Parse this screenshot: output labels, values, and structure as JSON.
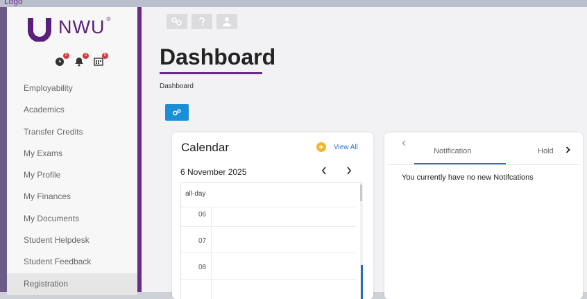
{
  "top_strip_text": "Logo",
  "brand": {
    "name": "NWU",
    "registered": "®"
  },
  "alerts": [
    {
      "icon": "clock-icon",
      "count": "0"
    },
    {
      "icon": "bell-icon",
      "count": "0"
    },
    {
      "icon": "calendar-icon",
      "count": "0"
    }
  ],
  "sidebar": {
    "items": [
      {
        "label": "Employability"
      },
      {
        "label": "Academics"
      },
      {
        "label": "Transfer Credits"
      },
      {
        "label": "My Exams"
      },
      {
        "label": "My Profile"
      },
      {
        "label": "My Finances"
      },
      {
        "label": "My Documents"
      },
      {
        "label": "Student Helpdesk"
      },
      {
        "label": "Student Feedback"
      },
      {
        "label": "Registration"
      }
    ],
    "active_item": "Registration"
  },
  "toolbar": {
    "icons": [
      "share-icon",
      "help-icon",
      "user-icon"
    ]
  },
  "page": {
    "title": "Dashboard",
    "breadcrumb": "Dashboard"
  },
  "calendar": {
    "title": "Calendar",
    "view_all": "View All",
    "date": "6 November 2025",
    "all_day": "all-day",
    "hours": [
      "06",
      "07",
      "08"
    ]
  },
  "notifications": {
    "tabs": [
      "Notification",
      "Hold"
    ],
    "active_tab": "Notification",
    "message": "You currently have no new Notifcations"
  },
  "colors": {
    "brand_purple": "#5b1f7a",
    "accent_blue": "#1a8fd6",
    "link_blue": "#2a72c6",
    "badge_red": "#d8383c",
    "view_all_icon": "#f2b62a"
  }
}
